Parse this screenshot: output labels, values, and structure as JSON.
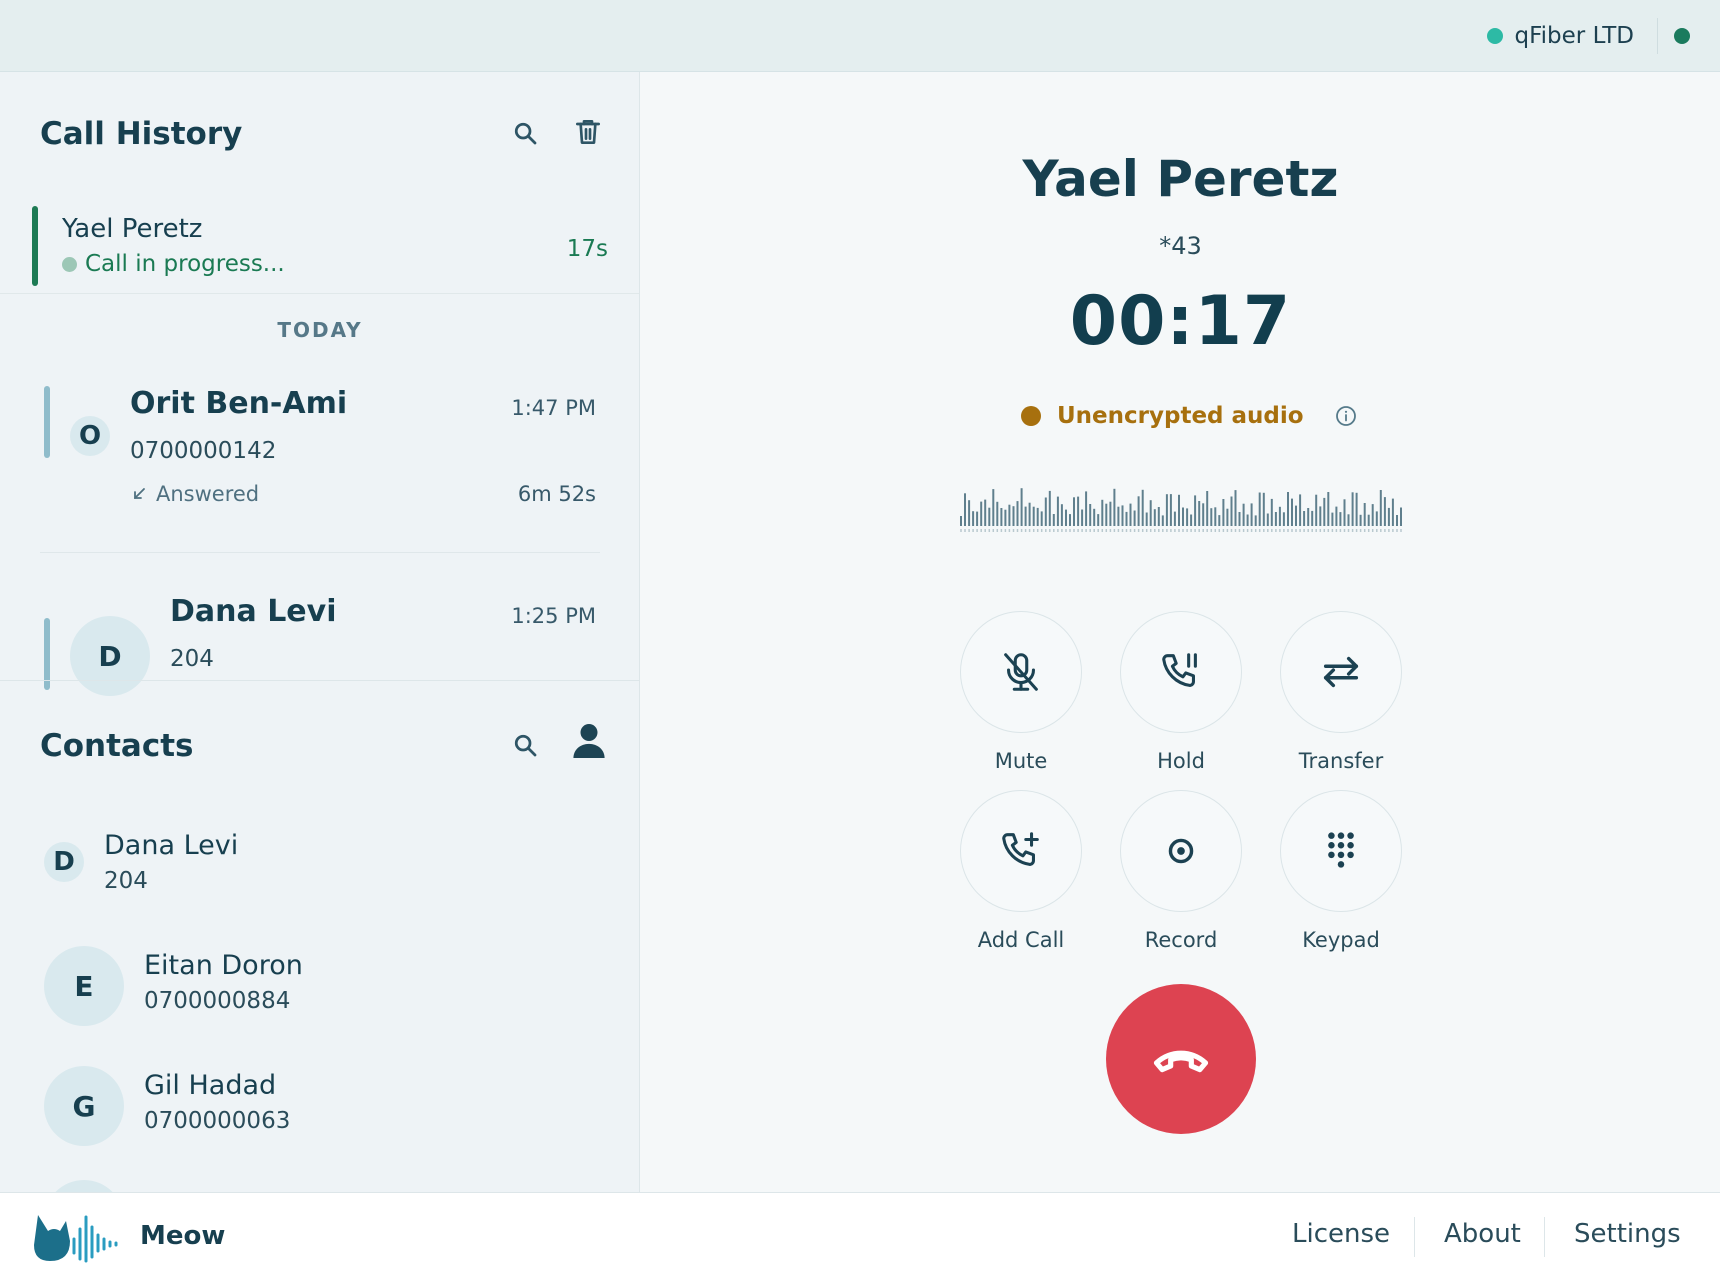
{
  "topbar": {
    "org_name": "qFiber LTD"
  },
  "call_history": {
    "title": "Call History",
    "search_icon": "search-icon",
    "delete_icon": "trash-icon",
    "active": {
      "name": "Yael Peretz",
      "status": "Call in progress...",
      "duration": "17s"
    },
    "group_label": "TODAY",
    "items": [
      {
        "initial": "O",
        "name": "Orit Ben-Ami",
        "number": "0700000142",
        "time": "1:47 PM",
        "direction": "Answered",
        "duration": "6m 52s"
      },
      {
        "initial": "D",
        "name": "Dana Levi",
        "number": "204",
        "time": "1:25 PM"
      }
    ]
  },
  "contacts": {
    "title": "Contacts",
    "search_icon": "search-icon",
    "person_icon": "person-icon",
    "items": [
      {
        "initial": "D",
        "name": "Dana Levi",
        "number": "204"
      },
      {
        "initial": "E",
        "name": "Eitan Doron",
        "number": "0700000884"
      },
      {
        "initial": "G",
        "name": "Gil Hadad",
        "number": "0700000063"
      }
    ]
  },
  "call": {
    "name": "Yael Peretz",
    "extension": "*43",
    "timer": "00:17",
    "encryption_label": "Unencrypted audio",
    "controls": {
      "mute": "Mute",
      "hold": "Hold",
      "transfer": "Transfer",
      "add_call": "Add Call",
      "record": "Record",
      "keypad": "Keypad"
    }
  },
  "footer": {
    "brand": "Meow",
    "links": {
      "license": "License",
      "about": "About",
      "settings": "Settings"
    }
  },
  "colors": {
    "accent_green": "#1d7a54",
    "warning": "#a7700e",
    "hangup": "#dd4351",
    "primary_text": "#173f4f"
  }
}
